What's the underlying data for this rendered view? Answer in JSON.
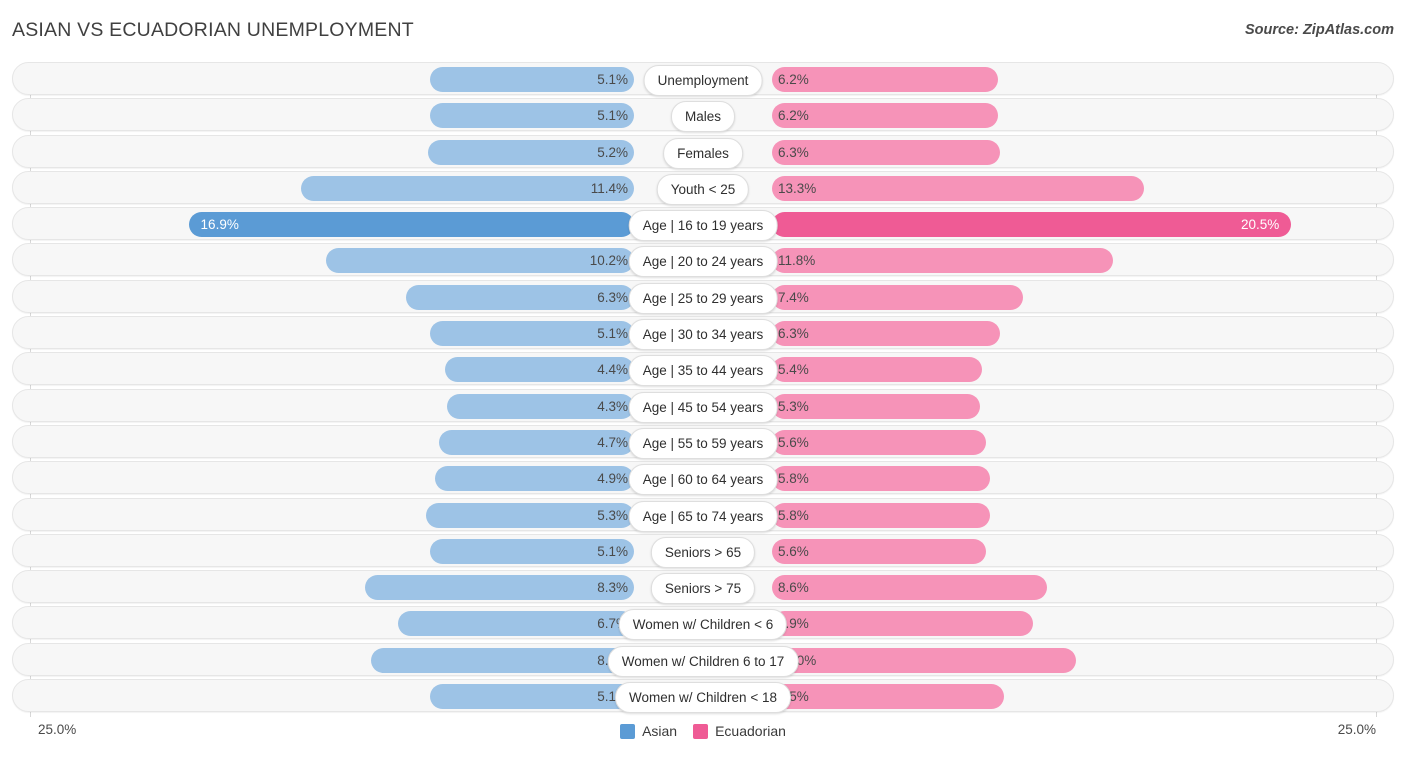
{
  "header": {
    "title": "ASIAN VS ECUADORIAN UNEMPLOYMENT",
    "source": "Source: ZipAtlas.com"
  },
  "axis": {
    "min_label": "25.0%",
    "max_label": "25.0%"
  },
  "legend": {
    "items": [
      {
        "label": "Asian",
        "color": "#5b9bd5",
        "key": "asian"
      },
      {
        "label": "Ecuadorian",
        "color": "#ef5b95",
        "key": "ecuadorian"
      }
    ]
  },
  "colors": {
    "asian": "#9dc3e6",
    "asian_highlight": "#5b9bd5",
    "ecuadorian": "#f693b8",
    "ecuadorian_highlight": "#ef5b95",
    "row_background": "#f7f7f7",
    "gridline": "#d8d8d8"
  },
  "chart_data": {
    "type": "bar",
    "title": "ASIAN VS ECUADORIAN UNEMPLOYMENT",
    "subtitle": "",
    "xlabel": "",
    "ylabel": "",
    "orientation": "horizontal-diverging",
    "axis_max_percent": 25.0,
    "xlim": [
      -25.0,
      25.0
    ],
    "grid": true,
    "legend_position": "bottom-center",
    "categories": [
      "Unemployment",
      "Males",
      "Females",
      "Youth < 25",
      "Age | 16 to 19 years",
      "Age | 20 to 24 years",
      "Age | 25 to 29 years",
      "Age | 30 to 34 years",
      "Age | 35 to 44 years",
      "Age | 45 to 54 years",
      "Age | 55 to 59 years",
      "Age | 60 to 64 years",
      "Age | 65 to 74 years",
      "Seniors > 65",
      "Seniors > 75",
      "Women w/ Children < 6",
      "Women w/ Children 6 to 17",
      "Women w/ Children < 18"
    ],
    "series": [
      {
        "name": "Asian",
        "color": "#9dc3e6",
        "values": [
          5.1,
          5.1,
          5.2,
          11.4,
          16.9,
          10.2,
          6.3,
          5.1,
          4.4,
          4.3,
          4.7,
          4.9,
          5.3,
          5.1,
          8.3,
          6.7,
          8.0,
          5.1
        ]
      },
      {
        "name": "Ecuadorian",
        "color": "#f693b8",
        "values": [
          6.2,
          6.2,
          6.3,
          13.3,
          20.5,
          11.8,
          7.4,
          6.3,
          5.4,
          5.3,
          5.6,
          5.8,
          5.8,
          5.6,
          8.6,
          7.9,
          10.0,
          6.5
        ]
      }
    ]
  },
  "rows": [
    {
      "category": "Unemployment",
      "asian": "5.1%",
      "ecuadorian": "6.2%",
      "highlight": false
    },
    {
      "category": "Males",
      "asian": "5.1%",
      "ecuadorian": "6.2%",
      "highlight": false
    },
    {
      "category": "Females",
      "asian": "5.2%",
      "ecuadorian": "6.3%",
      "highlight": false
    },
    {
      "category": "Youth < 25",
      "asian": "11.4%",
      "ecuadorian": "13.3%",
      "highlight": false
    },
    {
      "category": "Age | 16 to 19 years",
      "asian": "16.9%",
      "ecuadorian": "20.5%",
      "highlight": true
    },
    {
      "category": "Age | 20 to 24 years",
      "asian": "10.2%",
      "ecuadorian": "11.8%",
      "highlight": false
    },
    {
      "category": "Age | 25 to 29 years",
      "asian": "6.3%",
      "ecuadorian": "7.4%",
      "highlight": false
    },
    {
      "category": "Age | 30 to 34 years",
      "asian": "5.1%",
      "ecuadorian": "6.3%",
      "highlight": false
    },
    {
      "category": "Age | 35 to 44 years",
      "asian": "4.4%",
      "ecuadorian": "5.4%",
      "highlight": false
    },
    {
      "category": "Age | 45 to 54 years",
      "asian": "4.3%",
      "ecuadorian": "5.3%",
      "highlight": false
    },
    {
      "category": "Age | 55 to 59 years",
      "asian": "4.7%",
      "ecuadorian": "5.6%",
      "highlight": false
    },
    {
      "category": "Age | 60 to 64 years",
      "asian": "4.9%",
      "ecuadorian": "5.8%",
      "highlight": false
    },
    {
      "category": "Age | 65 to 74 years",
      "asian": "5.3%",
      "ecuadorian": "5.8%",
      "highlight": false
    },
    {
      "category": "Seniors > 65",
      "asian": "5.1%",
      "ecuadorian": "5.6%",
      "highlight": false
    },
    {
      "category": "Seniors > 75",
      "asian": "8.3%",
      "ecuadorian": "8.6%",
      "highlight": false
    },
    {
      "category": "Women w/ Children < 6",
      "asian": "6.7%",
      "ecuadorian": "7.9%",
      "highlight": false
    },
    {
      "category": "Women w/ Children 6 to 17",
      "asian": "8.0%",
      "ecuadorian": "10.0%",
      "highlight": false
    },
    {
      "category": "Women w/ Children < 18",
      "asian": "5.1%",
      "ecuadorian": "6.5%",
      "highlight": false
    }
  ]
}
